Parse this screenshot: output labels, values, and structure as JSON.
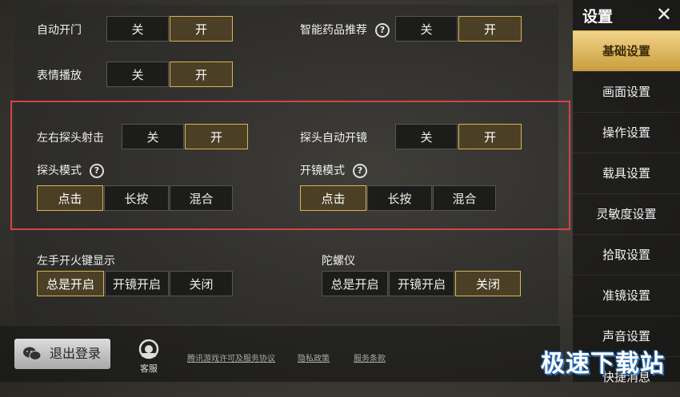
{
  "sidebar": {
    "title": "设置",
    "items": [
      "基础设置",
      "画面设置",
      "操作设置",
      "载具设置",
      "灵敏度设置",
      "拾取设置",
      "准镜设置",
      "声音设置",
      "快捷消息"
    ],
    "active_index": 0
  },
  "settings": {
    "auto_door": {
      "label": "自动开门",
      "options": [
        "关",
        "开"
      ],
      "selected": 1
    },
    "smart_medicine": {
      "label": "智能药品推荐",
      "options": [
        "关",
        "开"
      ],
      "selected": 1
    },
    "emote_play": {
      "label": "表情播放",
      "options": [
        "关",
        "开"
      ],
      "selected": 1
    },
    "lean_fire": {
      "label": "左右探头射击",
      "options": [
        "关",
        "开"
      ],
      "selected": 1
    },
    "lean_auto_scope": {
      "label": "探头自动开镜",
      "options": [
        "关",
        "开"
      ],
      "selected": 1
    },
    "lean_mode": {
      "label": "探头模式",
      "options": [
        "点击",
        "长按",
        "混合"
      ],
      "selected": 0
    },
    "scope_mode": {
      "label": "开镜模式",
      "options": [
        "点击",
        "长按",
        "混合"
      ],
      "selected": 0
    },
    "left_fire_btn": {
      "label": "左手开火键显示",
      "options": [
        "总是开启",
        "开镜开启",
        "关闭"
      ],
      "selected": 0
    },
    "gyroscope": {
      "label": "陀螺仪",
      "options": [
        "总是开启",
        "开镜开启",
        "关闭"
      ],
      "selected": 2
    }
  },
  "footer": {
    "logout": "退出登录",
    "customer_service": "客服",
    "links": [
      "腾讯游戏许可及服务协议",
      "隐私政策",
      "服务条款"
    ]
  },
  "watermark": "极速下载站",
  "help_glyph": "?",
  "close_glyph": "✕"
}
